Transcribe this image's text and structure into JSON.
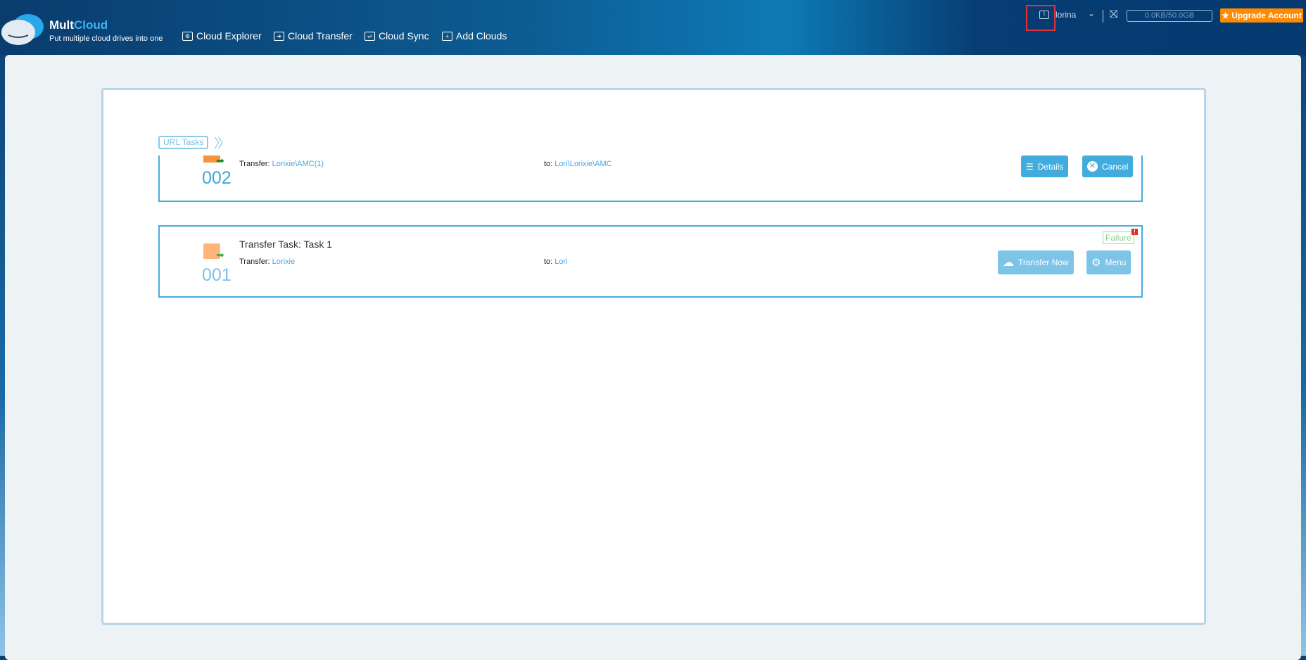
{
  "header": {
    "brand_a": "Mult",
    "brand_b": "Cloud",
    "tagline": "Put multiple cloud drives into one",
    "nav": [
      {
        "label": "Cloud Explorer",
        "icon": "gear"
      },
      {
        "label": "Cloud Transfer",
        "icon": "arrow"
      },
      {
        "label": "Cloud Sync",
        "icon": "sync"
      },
      {
        "label": "Add Clouds",
        "icon": "plus"
      }
    ],
    "username": "lorina",
    "usage": "0.0KB/50.0GB",
    "upgrade": "★ Upgrade Account"
  },
  "breadcrumb": "URL Tasks",
  "tasks": [
    {
      "number": "002",
      "transfer_label": "Transfer:",
      "source": "Lorixie\\AMC(1)",
      "to_label": "to:",
      "dest": "Lori\\Lorixie\\AMC",
      "buttons": [
        "Details",
        "Cancel"
      ]
    },
    {
      "number": "001",
      "title": "Transfer Task: Task 1",
      "transfer_label": "Transfer:",
      "source": "Lorixie",
      "to_label": "to:",
      "dest": "Lori",
      "status": "Failure",
      "buttons": [
        "Transfer Now",
        "Menu"
      ]
    }
  ]
}
